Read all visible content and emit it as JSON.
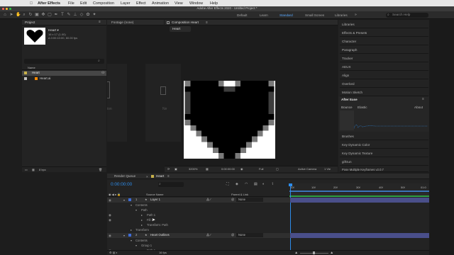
{
  "menubar": {
    "apple": "",
    "app": "After Effects",
    "items": [
      "File",
      "Edit",
      "Composition",
      "Layer",
      "Effect",
      "Animation",
      "View",
      "Window",
      "Help"
    ]
  },
  "titlebar": {
    "title": "Adobe After Effects 2020 - Untitled Project *"
  },
  "workspaces": [
    "Default",
    "Learn",
    "Standard",
    "Small Screen",
    "Libraries"
  ],
  "search": {
    "placeholder": "Search Help"
  },
  "project": {
    "tab": "Project",
    "item_name": "Heart ▾",
    "item_info1": "16 x 17 (1.00)",
    "item_info2": "Δ 0:00:10:00, 60.00 fps",
    "search_placeholder": "",
    "col_name": "Name",
    "items": [
      "Heart",
      "Heart.ai"
    ]
  },
  "viewer": {
    "footage_tab": "Footage (none)",
    "comp_tab": "Composition Heart",
    "breadcrumb": "Heart",
    "left_text": "ion",
    "mid_text": "Ne",
    "zoom": "3200%",
    "timecode": "0:00:00:00",
    "quality": "Full",
    "camera": "Active Camera",
    "views": "1 Vie"
  },
  "right_panel": {
    "items": [
      "Libraries",
      "Effects & Presets",
      "Character",
      "Paragraph",
      "Tracker",
      "AEUX",
      "Align",
      "Overlord",
      "Motion Sketch"
    ],
    "aftereases": {
      "title": "After Ease",
      "tab1": "Bounce",
      "tab2": "Elastic",
      "about": "About"
    },
    "items2": [
      "Brushes",
      "Key Dynamic Color",
      "Key Dynamic Texture",
      "gifGun",
      "Pose Multiple Keyframes v2.0.7"
    ]
  },
  "timeline": {
    "tabs": [
      "Render Queue",
      "Heart"
    ],
    "timecode": "0:00:00:00",
    "col_source": "Source Name",
    "col_parent": "Parent & Link",
    "ruler": [
      "00f",
      "10f",
      "20f",
      "30f",
      "40f",
      "50f",
      "01:0"
    ],
    "rows": [
      {
        "num": "1",
        "name": "Layer 1",
        "parent": "None"
      },
      {
        "name": "Contents"
      },
      {
        "name": "Path"
      },
      {
        "name": "Path 1"
      },
      {
        "name": "Fill 1"
      },
      {
        "name": "Transform: Path"
      },
      {
        "name": "Transform"
      },
      {
        "num": "2",
        "name": "Heart Outlines",
        "parent": "None"
      },
      {
        "name": "Contents"
      },
      {
        "name": "Group 1"
      },
      {
        "name": "Path 1"
      }
    ],
    "footer": "16 fps"
  },
  "colors": {
    "accent": "#2d8ceb",
    "layer_bar": "#4a4f8a",
    "heart": "#000000"
  }
}
